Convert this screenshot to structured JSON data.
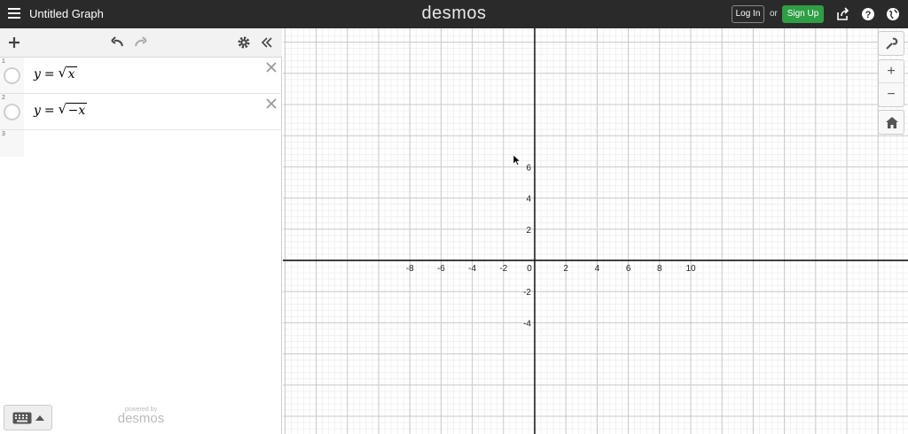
{
  "header": {
    "title": "Untitled Graph",
    "brand": "desmos",
    "login_label": "Log In",
    "or_text": "or",
    "signup_label": "Sign Up",
    "icons": [
      "menu-icon",
      "share-icon",
      "help-icon",
      "language-globe-icon"
    ]
  },
  "expressions": [
    {
      "number": "1",
      "lhs": "y",
      "op": "=",
      "radicand": "x"
    },
    {
      "number": "2",
      "lhs": "y",
      "op": "=",
      "radicand": "−x"
    },
    {
      "number": "3"
    }
  ],
  "powered_by": {
    "small": "powered by",
    "big": "desmos"
  },
  "graph": {
    "x_ticks": [
      "-8",
      "-6",
      "-4",
      "-2",
      "0",
      "2",
      "4",
      "6",
      "8",
      "10"
    ],
    "y_ticks": [
      "6",
      "4",
      "2",
      "-2",
      "-4"
    ],
    "axis_color": "#000000",
    "major_grid_color": "#c8c8c8",
    "minor_grid_color": "#ececec"
  },
  "colors": {
    "header_bg": "#2a2a2a",
    "signup_green": "#2f9e44"
  }
}
